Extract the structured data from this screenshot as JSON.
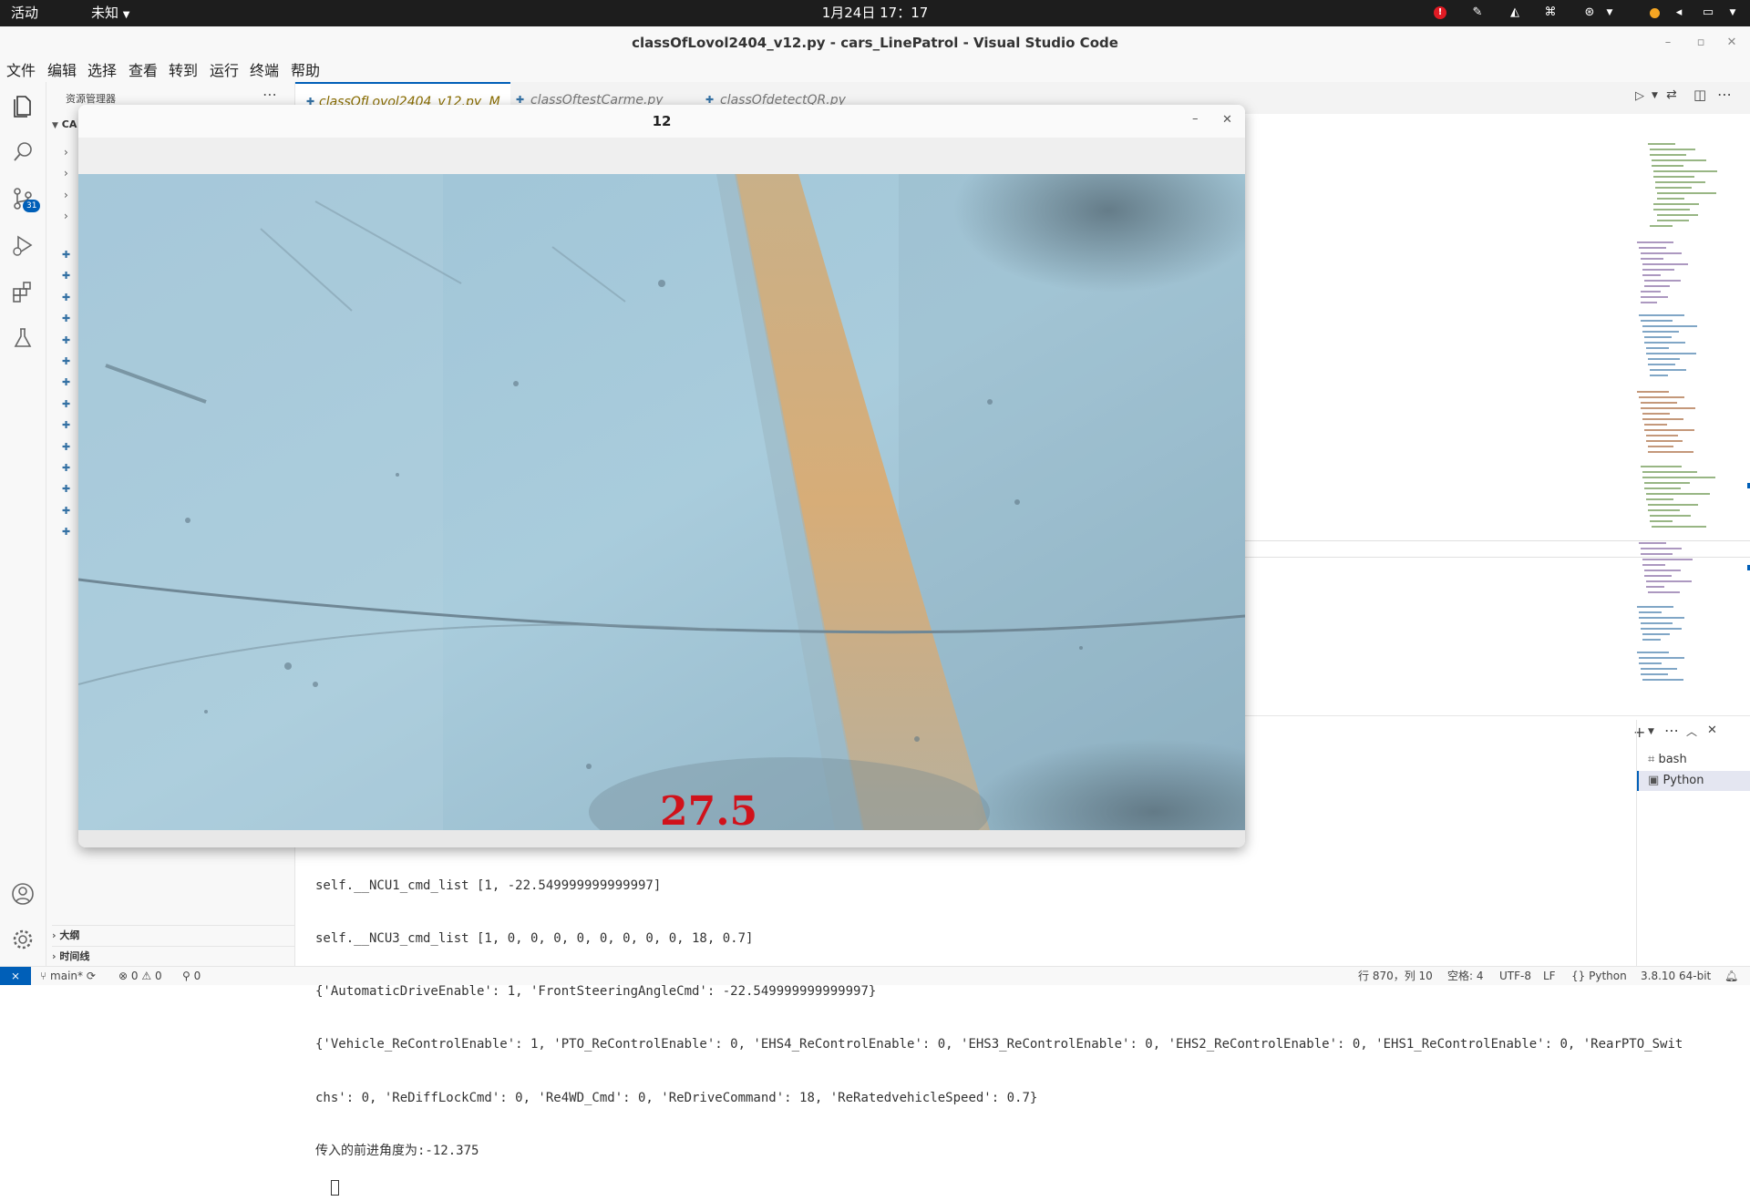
{
  "system_bar": {
    "activities": "活动",
    "app_menu": "未知",
    "clock": "1月24日 17：17"
  },
  "window": {
    "title": "classOfLovol2404_v12.py - cars_LinePatrol - Visual Studio Code"
  },
  "menu": {
    "items": [
      "文件",
      "编辑",
      "选择",
      "查看",
      "转到",
      "运行",
      "终端",
      "帮助"
    ]
  },
  "activity": {
    "scm_badge": "31"
  },
  "sidebar": {
    "header": "资源管理器",
    "folder_label": "CA",
    "outline": "大纲",
    "timeline": "时间线"
  },
  "tabs": [
    {
      "label": "classOfLovol2404_v12.py",
      "status": "M"
    },
    {
      "label": "classOftestCarme.py"
    },
    {
      "label": "classOfdetectQR.py"
    }
  ],
  "image_window": {
    "title": "12",
    "overlay_value": "27.5"
  },
  "terminal": {
    "lines": [
      "self.__NCU1_cmd_list [1, -22.549999999999997]",
      "self.__NCU3_cmd_list [1, 0, 0, 0, 0, 0, 0, 0, 0, 18, 0.7]",
      "{'AutomaticDriveEnable': 1, 'FrontSteeringAngleCmd': -22.549999999999997}",
      "{'Vehicle_ReControlEnable': 1, 'PTO_ReControlEnable': 0, 'EHS4_ReControlEnable': 0, 'EHS3_ReControlEnable': 0, 'EHS2_ReControlEnable': 0, 'EHS1_ReControlEnable': 0, 'RearPTO_Swit",
      "chs': 0, 'ReDiffLockCmd': 0, 'Re4WD_Cmd': 0, 'ReDriveCommand': 18, 'ReRatedvehicleSpeed': 0.7}",
      "传入的前进角度为:-12.375"
    ],
    "sessions": [
      "bash",
      "Python"
    ]
  },
  "status": {
    "branch": "main*",
    "errors": "0",
    "warnings": "0",
    "ports": "0",
    "position": "行 870，列 10",
    "spaces": "空格: 4",
    "encoding": "UTF-8",
    "eol": "LF",
    "language": "Python",
    "interpreter": "3.8.10 64-bit"
  },
  "colors": {
    "overlay_text": "#d0121b",
    "scm_badge_bg": "#005fb8",
    "remote_bg": "#005fb8"
  }
}
